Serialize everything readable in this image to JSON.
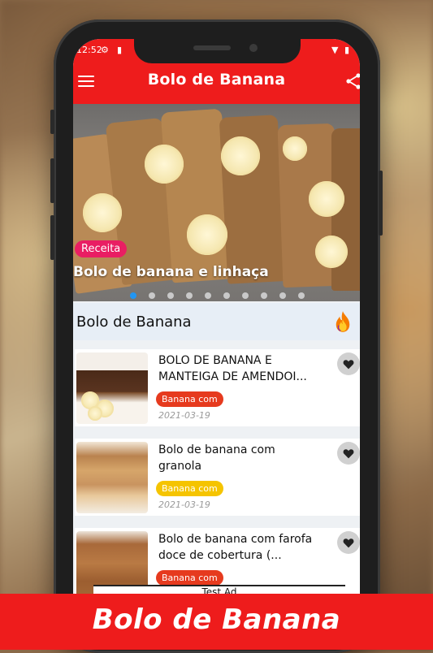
{
  "status": {
    "time": "12:52"
  },
  "appbar": {
    "title": "Bolo de Banana"
  },
  "carousel": {
    "tag": "Receita",
    "title": "Bolo de banana e linhaça",
    "dot_count": 10,
    "active_dot": 0
  },
  "section": {
    "title": "Bolo de Banana"
  },
  "cards": [
    {
      "title": "BOLO DE BANANA E MANTEIGA DE AMENDOI...",
      "chip": "Banana com",
      "chip_color": "#e63a1e",
      "date": "2021-03-19"
    },
    {
      "title": "Bolo de banana com granola",
      "chip": "Banana com",
      "chip_color": "#f5c400",
      "date": "2021-03-19"
    },
    {
      "title": "Bolo de banana com farofa doce de cobertura (...",
      "chip": "Banana com",
      "chip_color": "#e63a1e",
      "date": ""
    }
  ],
  "ad": {
    "label": "Test Ad"
  },
  "banner": {
    "text": "Bolo de Banana"
  },
  "colors": {
    "brand": "#ee1c1c",
    "accent_dot": "#2196f3",
    "tag": "#e91e63"
  }
}
